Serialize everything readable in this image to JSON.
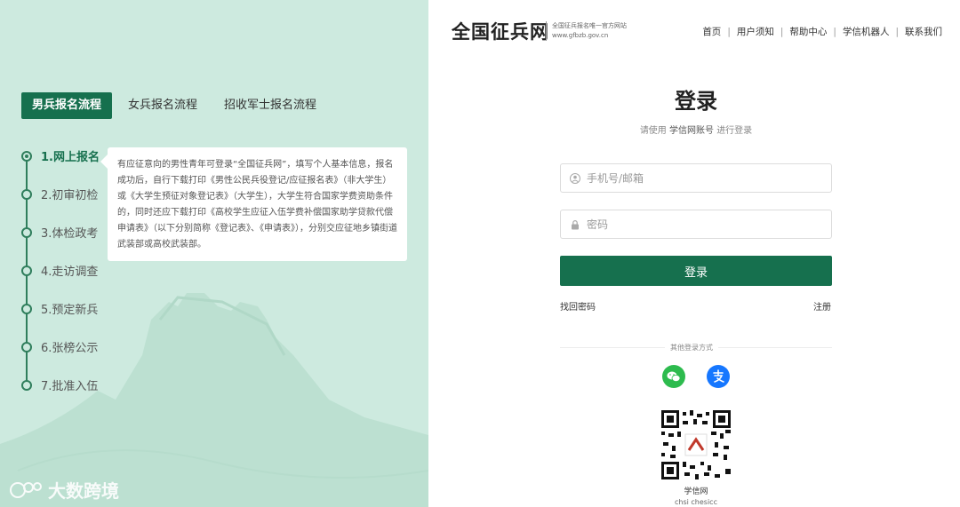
{
  "left": {
    "tabs": [
      "男兵报名流程",
      "女兵报名流程",
      "招收军士报名流程"
    ],
    "active_tab": 0,
    "steps": [
      "1.网上报名",
      "2.初审初检",
      "3.体检政考",
      "4.走访调查",
      "5.预定新兵",
      "6.张榜公示",
      "7.批准入伍"
    ],
    "active_step": 0,
    "tip_text": "有应征意向的男性青年可登录“全国征兵网”，填写个人基本信息，报名成功后，自行下载打印《男性公民兵役登记/应征报名表》（非大学生）或《大学生预征对象登记表》（大学生），大学生符合国家学费资助条件的，同时还应下载打印《高校学生应征入伍学费补偿国家助学贷款代偿申请表》（以下分别简称《登记表》、《申请表》），分别交应征地乡镇街道武装部或高校武装部。",
    "watermark": "大数跨境"
  },
  "header": {
    "logo": "全国征兵网",
    "logo_sub_line1": "全国征兵报名唯一官方网站",
    "logo_sub_line2": "www.gfbzb.gov.cn",
    "nav": [
      "首页",
      "用户须知",
      "帮助中心",
      "学信机器人",
      "联系我们"
    ]
  },
  "login": {
    "title": "登录",
    "subtitle_prefix": "请使用",
    "subtitle_account": "学信网账号",
    "subtitle_suffix": "进行登录",
    "username_placeholder": "手机号/邮箱",
    "password_placeholder": "密码",
    "button": "登录",
    "forgot": "找回密码",
    "register": "注册",
    "other_methods": "其他登录方式",
    "qr_label": "学信网",
    "qr_sub": "chsi  chesicc"
  },
  "colors": {
    "primary": "#16704e",
    "left_bg": "#cdeadf",
    "wechat": "#2dbb4e",
    "alipay": "#1677ff"
  }
}
